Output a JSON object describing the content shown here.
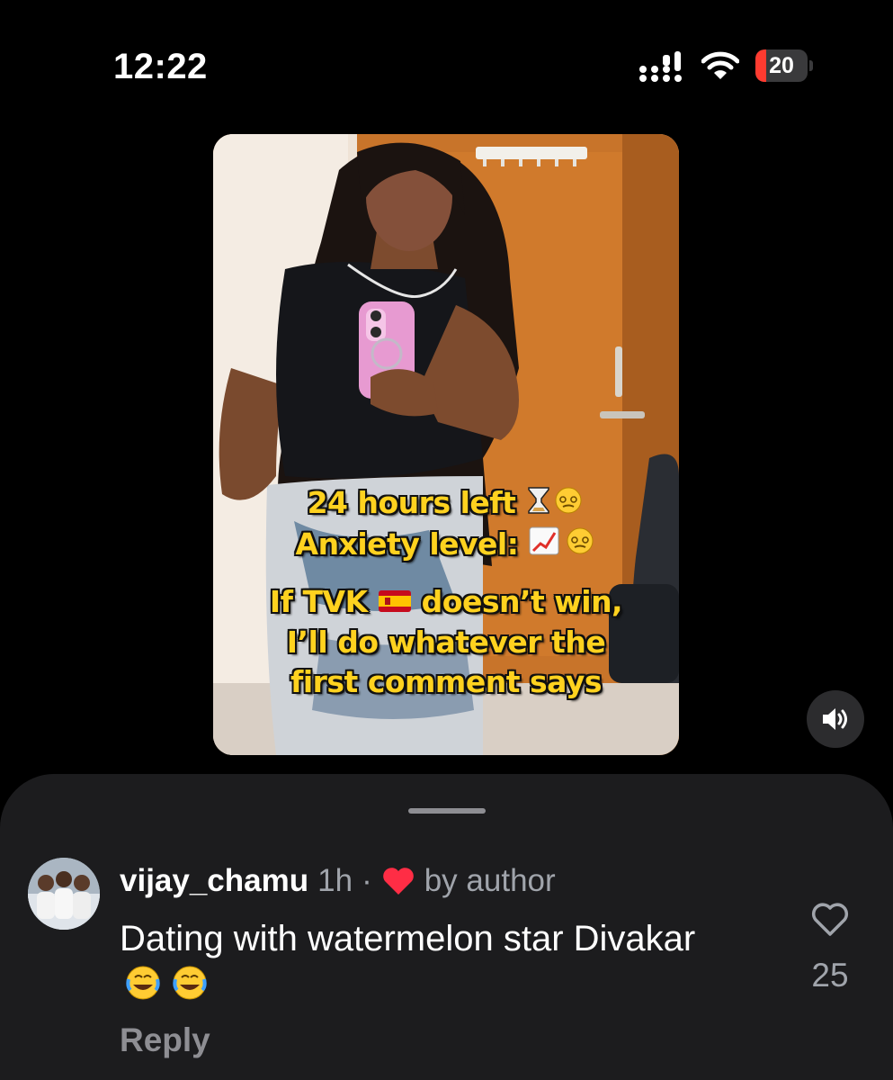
{
  "status_bar": {
    "time": "12:22",
    "battery_level": "20",
    "battery_fraction": 0.2
  },
  "video": {
    "overlay_lines": [
      "24 hours left",
      "Anxiety level:",
      "If TVK",
      "doesn’t win,",
      "I’ll do whatever the",
      "first comment says"
    ],
    "emojis": {
      "line1": "⏳😵‍💫",
      "line2": "📈😵‍💫"
    },
    "volume_icon": "speaker-icon"
  },
  "comment": {
    "username": "vijay_chamu",
    "time": "1h",
    "separator": "·",
    "author_tag": "by author",
    "text": "Dating with watermelon star Divakar",
    "emoji": "😂 😂",
    "reply_label": "Reply",
    "like_count": "25",
    "like_icon": "heart-outline-icon",
    "author_heart_color": "#ff2d45"
  }
}
